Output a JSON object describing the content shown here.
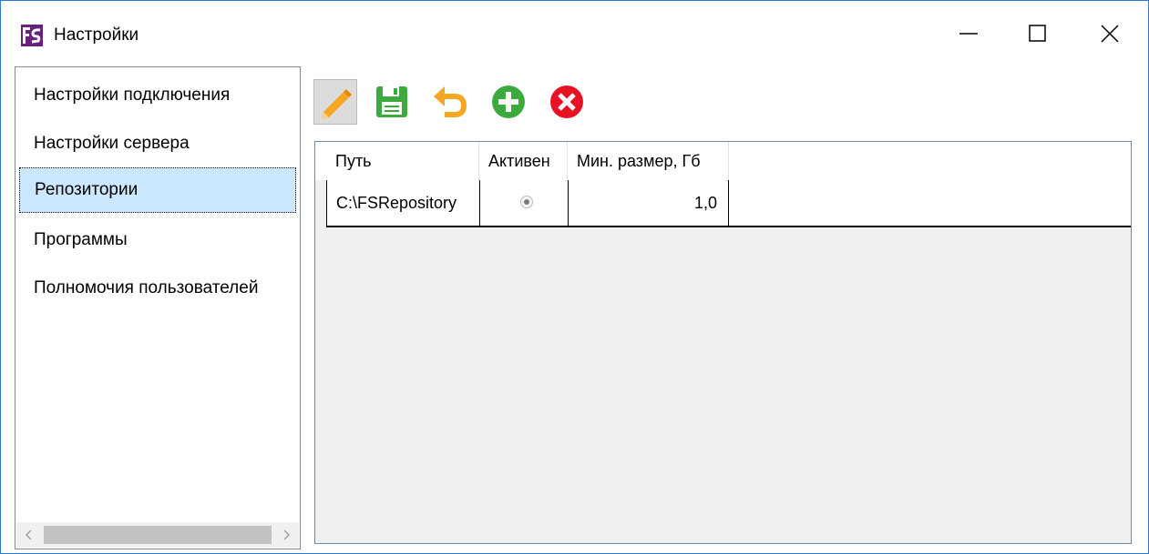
{
  "window": {
    "title": "Настройки",
    "controls": {
      "minimize": "minimize",
      "maximize": "maximize",
      "close": "close"
    }
  },
  "sidebar": {
    "items": [
      {
        "label": "Настройки подключения",
        "selected": false
      },
      {
        "label": "Настройки сервера",
        "selected": false
      },
      {
        "label": "Репозитории",
        "selected": true
      },
      {
        "label": "Программы",
        "selected": false
      },
      {
        "label": "Полномочия пользователей",
        "selected": false
      }
    ]
  },
  "toolbar": {
    "buttons": [
      {
        "icon": "pencil-icon",
        "action": "edit",
        "pressed": true
      },
      {
        "icon": "floppy-disk-icon",
        "action": "save",
        "pressed": false
      },
      {
        "icon": "undo-arrow-icon",
        "action": "undo",
        "pressed": false
      },
      {
        "icon": "plus-circle-icon",
        "action": "add",
        "pressed": false
      },
      {
        "icon": "x-circle-icon",
        "action": "delete",
        "pressed": false
      }
    ]
  },
  "grid": {
    "columns": [
      "Путь",
      "Активен",
      "Мин. размер, Гб"
    ],
    "rows": [
      {
        "path": "C:\\FSRepository",
        "active": true,
        "min_size": "1,0"
      }
    ]
  },
  "colors": {
    "accent": "#2b7ccc",
    "selection": "#cce8ff",
    "app_icon": "#68217a",
    "save_green": "#3caa3c",
    "undo_orange": "#f5a623",
    "delete_red": "#e81123"
  }
}
